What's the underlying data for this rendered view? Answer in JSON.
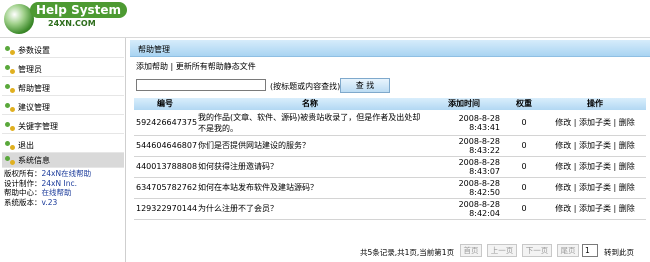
{
  "header": {
    "logo_title": "Help System",
    "logo_site": "24XN.COM"
  },
  "sidebar": {
    "items": [
      {
        "label": "参数设置",
        "icon": "settings-icon"
      },
      {
        "label": "管理员",
        "icon": "admin-icon"
      },
      {
        "label": "帮助管理",
        "icon": "help-icon"
      },
      {
        "label": "建议管理",
        "icon": "suggestion-icon"
      },
      {
        "label": "关键字管理",
        "icon": "keyword-icon"
      },
      {
        "label": "退出",
        "icon": "logout-icon"
      },
      {
        "label": "系统信息",
        "icon": "info-icon"
      }
    ],
    "active_label": "系统信息",
    "sysinfo": {
      "copyright_k": "版权所有：",
      "copyright_v": "24xN在线帮助",
      "design_k": "设计制作：",
      "design_v": "24xN Inc.",
      "center_k": "帮助中心：",
      "center_v": "在线帮助",
      "version_k": "系统版本：",
      "version_v": "v.23"
    }
  },
  "main": {
    "panel_title": "帮助管理",
    "link_add": "添加帮助",
    "link_sep": "|",
    "link_update": "更新所有帮助静态文件",
    "search_hint": "(按标题或内容查找)",
    "search_button": "查 找",
    "columns": [
      "编号",
      "名称",
      "添加时间",
      "权重",
      "操作"
    ],
    "rows": [
      {
        "id": "592426647375",
        "name": "我的作品(文章、软件、源码)被贵站收录了，但是作者及出处却不是我的。",
        "time": "2008-8-28 8:43:41",
        "weight": "0",
        "op_edit": "修改",
        "op_add": "添加子类",
        "op_del": "删除"
      },
      {
        "id": "544604646807",
        "name": "你们是否提供网站建设的服务？",
        "time": "2008-8-28 8:43:22",
        "weight": "0",
        "op_edit": "修改",
        "op_add": "添加子类",
        "op_del": "删除"
      },
      {
        "id": "440013788808",
        "name": "如何获得注册邀请码？",
        "time": "2008-8-28 8:43:07",
        "weight": "0",
        "op_edit": "修改",
        "op_add": "添加子类",
        "op_del": "删除"
      },
      {
        "id": "634705782762",
        "name": "如何在本站发布软件及建站源码？",
        "time": "2008-8-28 8:42:50",
        "weight": "0",
        "op_edit": "修改",
        "op_add": "添加子类",
        "op_del": "删除"
      },
      {
        "id": "129322970144",
        "name": "为什么注册不了会员？",
        "time": "2008-8-28 8:42:04",
        "weight": "0",
        "op_edit": "修改",
        "op_add": "添加子类",
        "op_del": "删除"
      }
    ],
    "op_sep": "|",
    "pager": {
      "info": "共5条记录,共1页,当前第1页",
      "first": "首页",
      "prev": "上一页",
      "next": "下一页",
      "last": "尾页",
      "page_value": "1",
      "goto": "转到此页"
    }
  },
  "colors": {
    "panel_header": "#a9d4f2",
    "table_header": "#b2d8f3",
    "logo_green": "#4d9a32",
    "link_blue": "#1a3a9a"
  }
}
